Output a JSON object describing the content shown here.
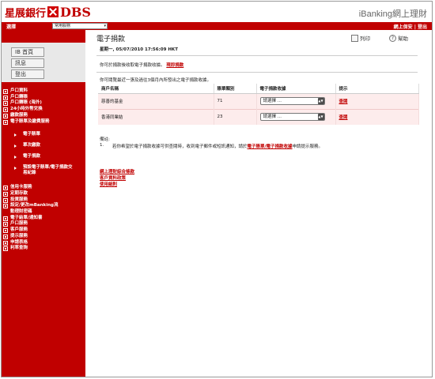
{
  "header": {
    "logo_cn": "星展銀行",
    "logo_en": "DBS",
    "brand": "iBanking網上理財"
  },
  "topbar": {
    "label": "選擇",
    "select_value": "常用服務",
    "right_label": "網上保安 | 登出"
  },
  "quick_links": [
    {
      "label": "IB 首頁"
    },
    {
      "label": "訊息"
    },
    {
      "label": "登出"
    }
  ],
  "nav_top": [
    "戶口資料",
    "戶口轉賬",
    "戶口轉賬 (海外)",
    "24小時外幣兌換",
    "繳款服務",
    "電子賬單及繳費服務"
  ],
  "nav_sub": [
    "電子賬單",
    "單次繳款",
    "電子捐款",
    "預設電子賬單/電子捐款交易紀錄"
  ],
  "nav_bottom": [
    "信用卡服務",
    "定期存款",
    "投資服務",
    "設定/更改mBanking流動理財密碼",
    "電子結單/通知書",
    "戶口服務",
    "客戶服務",
    "提示服務",
    "申請表格",
    "利率查詢"
  ],
  "main": {
    "title": "電子捐款",
    "print_label": "列印",
    "help_label": "幫助",
    "datetime": "星期一, 05/07/2010 17:56:09 HKT",
    "intro_text": "你可於捐款後收取電子捐款收據。",
    "intro_link": "現即捐款",
    "list_text": "你可閱覽最近一張及過往3個月內所發出之電子捐款收據。",
    "table_headers": [
      "商戶名稱",
      "賬單類別",
      "電子捐款收據",
      "提示"
    ],
    "rows": [
      {
        "merchant": "慈善的基金",
        "category": "71",
        "receipt": "請選擇 ...",
        "hint": "查閱"
      },
      {
        "merchant": "香港同業結",
        "category": "23",
        "receipt": "請選擇 ...",
        "hint": "查閱"
      }
    ],
    "note_title": "備註:",
    "note_num": "1.",
    "note_text_a": "若你希望於電子捐款收據可供查閱時，收到電子郵件或短訊通知，請於",
    "note_link": "電子賬單/電子捐款收據",
    "note_text_b": "申請提示服務。",
    "footer_links": [
      "網上理財綜合條款",
      "客戶資料政策",
      "使用細則"
    ]
  }
}
